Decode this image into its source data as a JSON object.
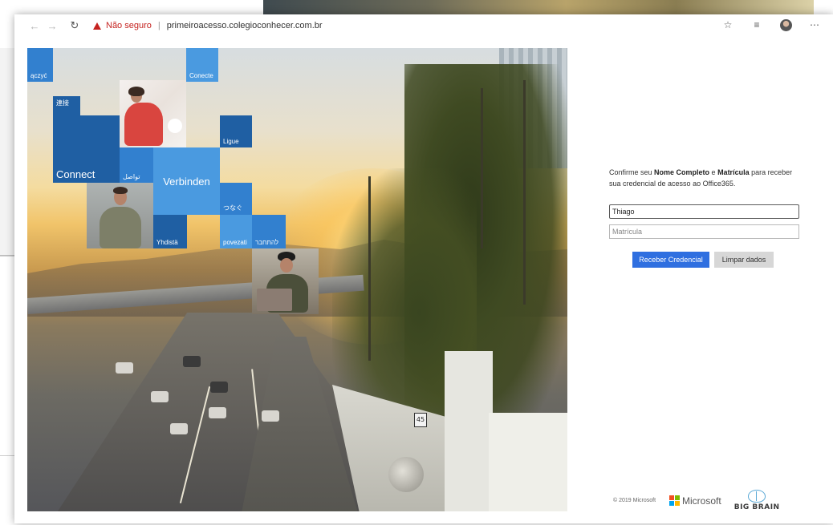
{
  "browser": {
    "security_label": "Não seguro",
    "separator": "|",
    "url": "primeiroacesso.colegioconhecer.com.br",
    "icons": [
      "back-arrow-icon",
      "forward-arrow-icon",
      "reload-icon",
      "warning-icon",
      "star-icon",
      "reading-list-icon",
      "avatar-icon",
      "more-icon"
    ]
  },
  "hero": {
    "tiles": {
      "polish": "ączyć",
      "chinese": "連接",
      "portuguese": "Conecte",
      "ligue": "Ligue",
      "connect": "Connect",
      "arabic": "تواصل",
      "german": "Verbinden",
      "japanese": "つなぐ",
      "finnish": "Yhdistä",
      "povezati": "povezati",
      "hebrew": "להתחבר"
    },
    "sign": "45"
  },
  "form": {
    "intro_prefix": "Confirme seu ",
    "intro_name": "Nome Completo",
    "intro_and": " e ",
    "intro_reg": "Matrícula",
    "intro_suffix": " para receber sua credencial de acesso ao Office365.",
    "name_value": "Thiago",
    "registration_placeholder": "Matrícula",
    "submit_label": "Receber Credencial",
    "clear_label": "Limpar dados"
  },
  "footer": {
    "copyright": "© 2019 Microsoft",
    "microsoft": "Microsoft",
    "bigbrain": "BIG BRAIN"
  },
  "colors": {
    "accent": "#2f6fe0",
    "warning": "#c5221f",
    "tile_blue": "#2b6cb0",
    "ms_red": "#f25022",
    "ms_green": "#7fba00",
    "ms_blue": "#00a4ef",
    "ms_yellow": "#ffb900"
  }
}
